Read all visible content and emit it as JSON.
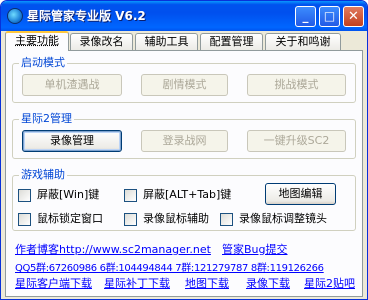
{
  "window": {
    "title": "星际管家专业版 V6.2",
    "controls": {
      "minimize": "_",
      "maximize": "□",
      "close": "✕"
    }
  },
  "tabs": [
    {
      "label": "主要功能",
      "active": true
    },
    {
      "label": "录像改名"
    },
    {
      "label": "辅助工具"
    },
    {
      "label": "配置管理"
    },
    {
      "label": "关于和鸣谢"
    }
  ],
  "launch_mode": {
    "title": "启动模式",
    "buttons": [
      "单机渣遇战",
      "剧情模式",
      "挑战模式"
    ]
  },
  "sc2_manage": {
    "title": "星际2管理",
    "buttons": [
      "录像管理",
      "登录战网",
      "一键升级SC2"
    ]
  },
  "game_assist": {
    "title": "游戏辅助",
    "checkboxes": [
      "屏蔽[Win]键",
      "屏蔽[ALT+Tab]键",
      "鼠标锁定窗口",
      "录像鼠标辅助",
      "录像鼠标调整镜头"
    ],
    "map_edit_button": "地图编辑"
  },
  "footer": {
    "author_blog": "作者博客http://www.sc2manager.net",
    "bug_report": "管家Bug提交",
    "qq_groups": "QQ5群:67260986 6群:104494844 7群:121279787 8群:119126266",
    "download_links": [
      "星际客户端下载",
      "星际补丁下载",
      "地图下载",
      "录像下载",
      "星际2贴吧"
    ]
  }
}
